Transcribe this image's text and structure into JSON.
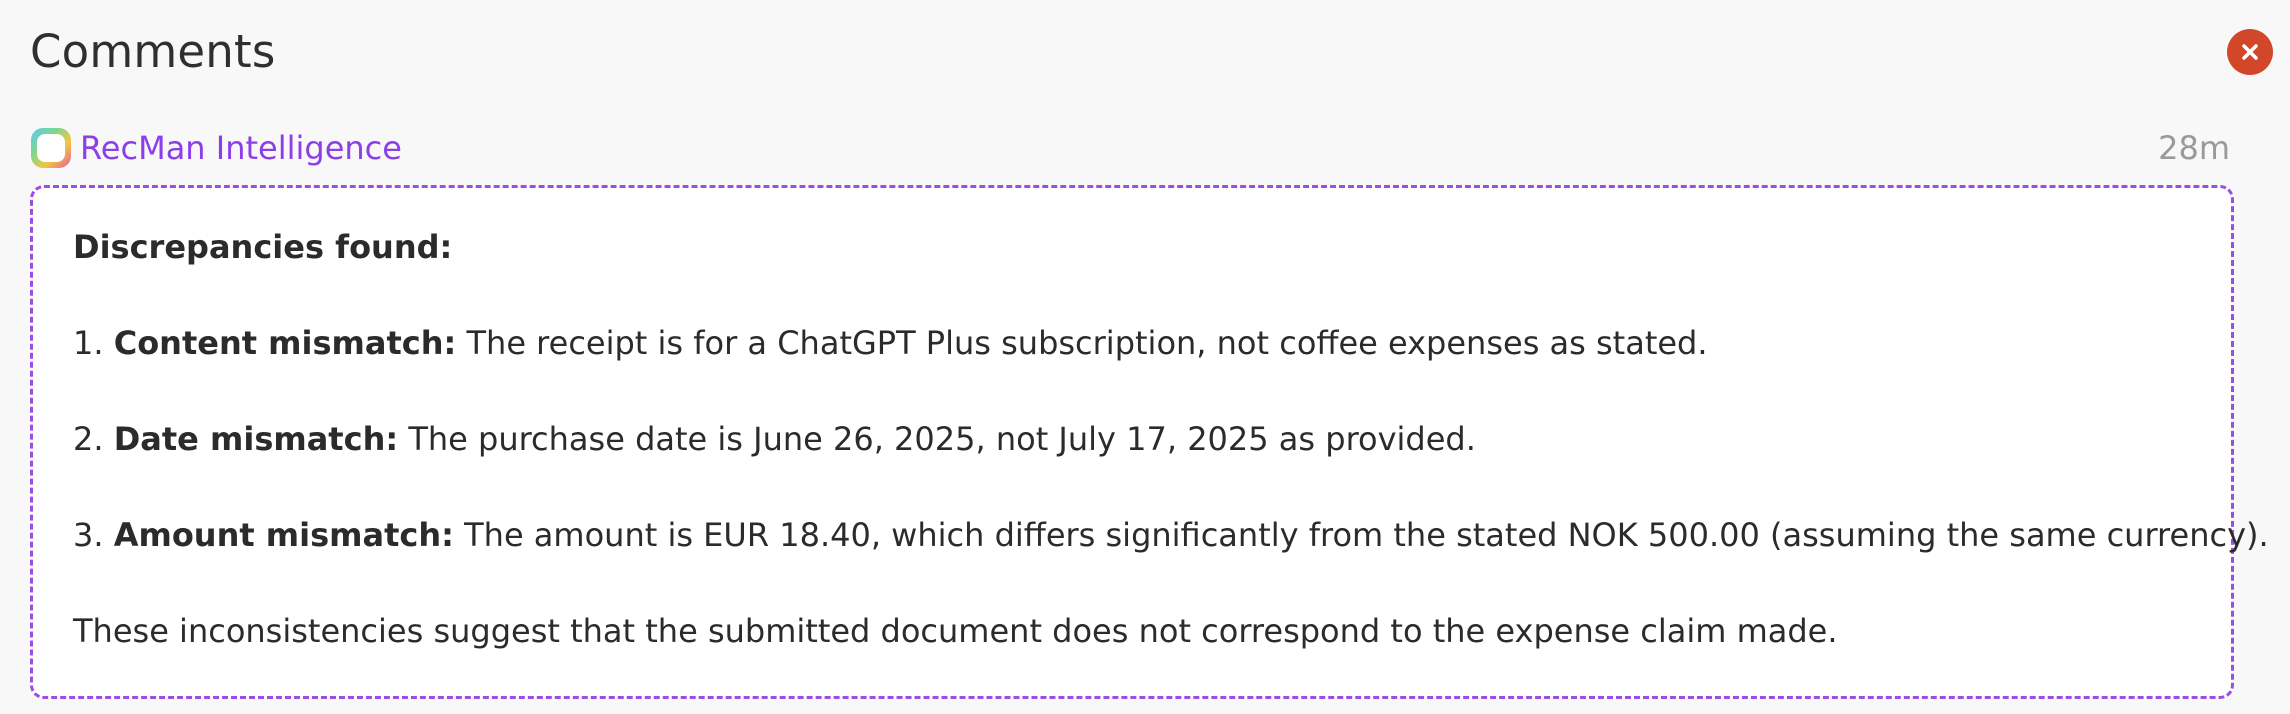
{
  "panel": {
    "title": "Comments",
    "close_icon": "close-icon"
  },
  "comment": {
    "author": "RecMan Intelligence",
    "author_icon": "ai-logo-icon",
    "time": "28m",
    "heading": "Discrepancies found:",
    "items": [
      {
        "number": "1.",
        "label": "Content mismatch:",
        "text": " The receipt is for a ChatGPT Plus subscription, not coffee expenses as stated."
      },
      {
        "number": "2.",
        "label": "Date mismatch:",
        "text": " The purchase date is June 26, 2025, not July 17, 2025 as provided."
      },
      {
        "number": "3.",
        "label": "Amount mismatch:",
        "text": " The amount is EUR 18.40, which differs significantly from the stated NOK 500.00 (assuming the same currency)."
      }
    ],
    "conclusion": "These inconsistencies suggest that the submitted document does not correspond to the expense claim made."
  },
  "colors": {
    "accent": "#8c3fe8",
    "close": "#d2462a",
    "border": "#9b4de8"
  }
}
